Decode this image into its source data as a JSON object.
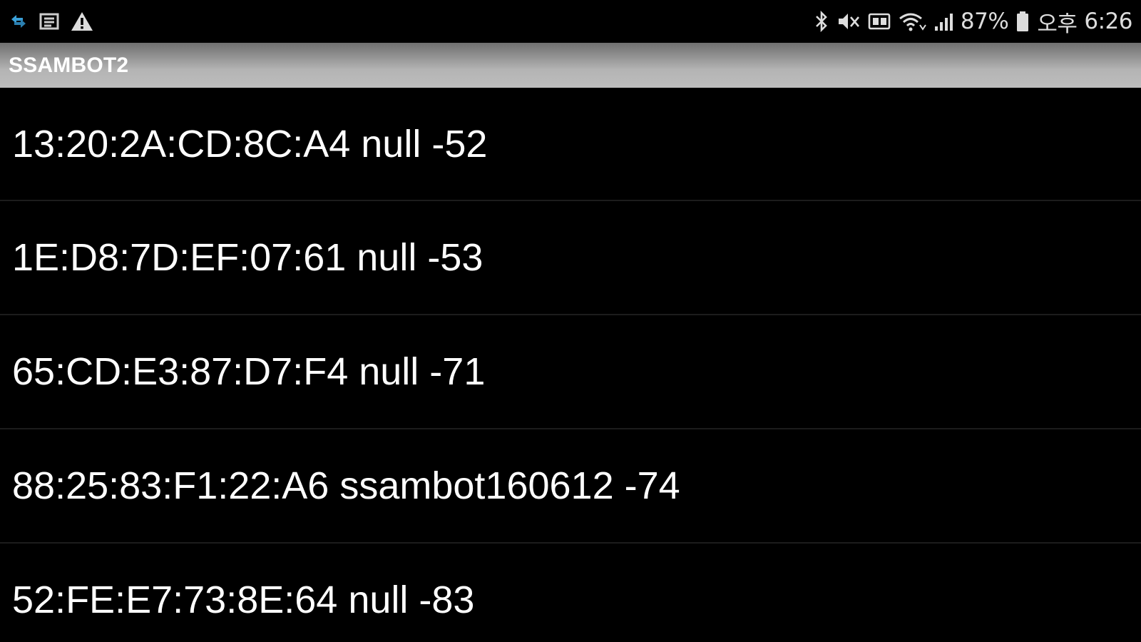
{
  "status_bar": {
    "left_icons": [
      "sync-arrows-icon",
      "notes-icon",
      "warning-icon"
    ],
    "right_icons": [
      "bluetooth-icon",
      "mute-icon",
      "sim-icon",
      "wifi-icon",
      "signal-icon",
      "battery-icon"
    ],
    "battery_percent": "87%",
    "period": "오후",
    "time": "6:26"
  },
  "app": {
    "title": "SSAMBOT2"
  },
  "devices": [
    {
      "label": "13:20:2A:CD:8C:A4 null -52"
    },
    {
      "label": "1E:D8:7D:EF:07:61 null -53"
    },
    {
      "label": "65:CD:E3:87:D7:F4 null -71"
    },
    {
      "label": "88:25:83:F1:22:A6 ssambot160612 -74"
    },
    {
      "label": "52:FE:E7:73:8E:64 null -83"
    }
  ],
  "colors": {
    "background": "#000000",
    "title_bar_top": "#6f6f6f",
    "title_bar_bottom": "#bdbdbd",
    "sync_icon": "#3aa0d8",
    "text": "#ffffff"
  }
}
